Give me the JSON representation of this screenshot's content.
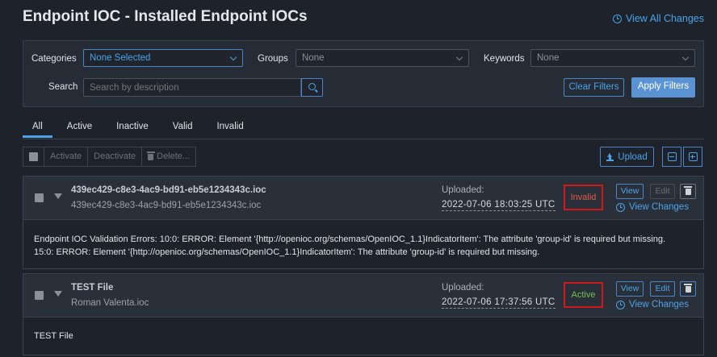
{
  "header": {
    "title": "Endpoint IOC - Installed Endpoint IOCs",
    "view_all_changes": "View All Changes"
  },
  "filters": {
    "categories_label": "Categories",
    "categories_value": "None Selected",
    "groups_label": "Groups",
    "groups_placeholder": "None",
    "keywords_label": "Keywords",
    "keywords_placeholder": "None",
    "search_label": "Search",
    "search_placeholder": "Search by description",
    "clear_label": "Clear Filters",
    "apply_label": "Apply Filters"
  },
  "tabs": [
    {
      "label": "All",
      "active": true
    },
    {
      "label": "Active",
      "active": false
    },
    {
      "label": "Inactive",
      "active": false
    },
    {
      "label": "Valid",
      "active": false
    },
    {
      "label": "Invalid",
      "active": false
    }
  ],
  "toolbar": {
    "activate": "Activate",
    "deactivate": "Deactivate",
    "delete": "Delete...",
    "upload": "Upload"
  },
  "iocs": [
    {
      "name": "439ec429-c8e3-4ac9-bd91-eb5e1234343c.ioc",
      "filename": "439ec429-c8e3-4ac9-bd91-eb5e1234343c.ioc",
      "uploaded_label": "Uploaded:",
      "uploaded_date": "2022-07-06 18:03:25 UTC",
      "status": "Invalid",
      "view": "View",
      "edit": "Edit",
      "view_changes": "View Changes",
      "body_line1": "Endpoint IOC Validation Errors: 10:0: ERROR: Element '{http://openioc.org/schemas/OpenIOC_1.1}IndicatorItem': The attribute 'group-id' is required but missing.",
      "body_line2": "15:0: ERROR: Element '{http://openioc.org/schemas/OpenIOC_1.1}IndicatorItem': The attribute 'group-id' is required but missing."
    },
    {
      "name": "TEST File",
      "filename": "Roman Valenta.ioc",
      "uploaded_label": "Uploaded:",
      "uploaded_date": "2022-07-06 17:37:56 UTC",
      "status": "Active",
      "view": "View",
      "edit": "Edit",
      "view_changes": "View Changes",
      "body_line1": "TEST File"
    }
  ],
  "colors": {
    "accent": "#4aa3e8",
    "invalid": "#e05a4a",
    "active": "#6ec24e",
    "highlight_border": "#d01818"
  }
}
